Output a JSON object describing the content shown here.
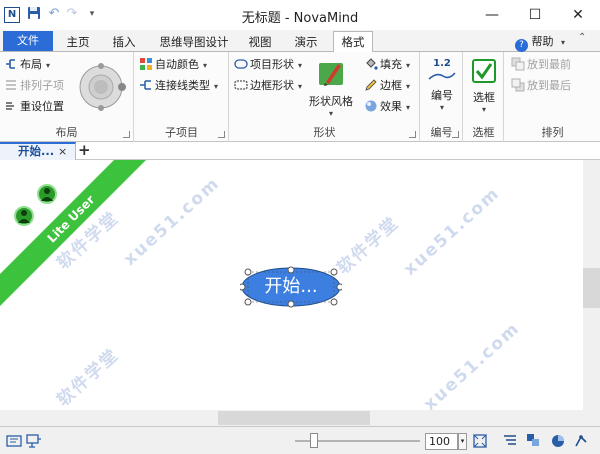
{
  "app": {
    "logo_letter": "N",
    "title": "无标题 - NovaMind"
  },
  "window_controls": {
    "minimize": "—",
    "maximize": "☐",
    "close": "✕"
  },
  "tabs": {
    "file": "文件",
    "home": "主页",
    "insert": "插入",
    "mindmap_design": "思维导图设计",
    "view": "视图",
    "present": "演示",
    "format": "格式",
    "active": "格式"
  },
  "help": {
    "label": "帮助",
    "glyph": "?"
  },
  "ribbon": {
    "layout_group": {
      "label": "布局",
      "layout": "布局",
      "arrange_children": "排列子项",
      "reset_position": "重设位置"
    },
    "children_group": {
      "label": "子项目",
      "auto_color": "自动颜色",
      "connector_type": "连接线类型"
    },
    "shape_group": {
      "label": "形状",
      "item_shape": "项目形状",
      "border_shape": "边框形状",
      "shape_style": "形状风格",
      "fill": "填充",
      "border": "边框",
      "effect": "效果"
    },
    "numbering_group": {
      "label": "编号",
      "button": "编号",
      "icon_text": "1.2"
    },
    "checkbox_group": {
      "label": "选框",
      "button": "选框"
    },
    "arrange_group": {
      "label": "排列",
      "bring_front": "放到最前",
      "send_back": "放到最后"
    }
  },
  "document_tab": {
    "label": "开始...",
    "close": "×",
    "new_tab": "+"
  },
  "canvas": {
    "ribbon_banner": "Lite User",
    "root_node": "开始...",
    "watermarks": [
      "软件学堂",
      "xue51.com",
      "软件学堂",
      "xue51.com",
      "软件学堂",
      "xue51.com"
    ]
  },
  "statusbar": {
    "zoom_value": "100",
    "zoom_slider_fraction": 0.15
  },
  "colors": {
    "accent": "#2b6cd6",
    "node_fill": "#3d7fe0",
    "banner_green": "#3cc23c",
    "checkbox_green": "#1f9a2a"
  }
}
